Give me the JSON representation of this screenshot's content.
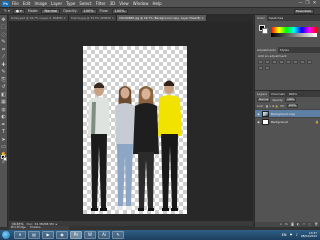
{
  "app": {
    "logo": "Ps"
  },
  "menubar": {
    "items": [
      "File",
      "Edit",
      "Image",
      "Layer",
      "Type",
      "Select",
      "Filter",
      "3D",
      "View",
      "Window",
      "Help"
    ],
    "window_controls": [
      "—",
      "❐",
      "✕"
    ]
  },
  "options_bar": {
    "mode_label": "Mode:",
    "mode_value": "Normal",
    "opacity_label": "Opacity:",
    "opacity_value": "100%",
    "flow_label": "Flow:",
    "flow_value": "100%",
    "workspace": "Essentials"
  },
  "document_tabs": [
    {
      "label": "family.psd @ 16.7% (Layer 0, RGB/8) ×",
      "active": false
    },
    {
      "label": "friends.jpg @ 33.3% (RGB/8) ×",
      "active": false
    },
    {
      "label": "DSC09868.jpg @ 16.7% (Background copy, Layer Mask/8) ×",
      "active": true
    }
  ],
  "status_bar": {
    "zoom": "16.67%",
    "doc_info": "Doc: 34.3M/68.5M",
    "arrow": "▸"
  },
  "tools": [
    "move-icon",
    "marquee-icon",
    "lasso-icon",
    "quick-select-icon",
    "crop-icon",
    "eyedropper-icon",
    "healing-icon",
    "brush-icon",
    "clone-icon",
    "history-brush-icon",
    "eraser-icon",
    "gradient-icon",
    "blur-icon",
    "dodge-icon",
    "pen-icon",
    "type-icon",
    "path-select-icon",
    "shape-icon",
    "hand-icon",
    "zoom-icon"
  ],
  "tool_glyphs": [
    "✥",
    "⬚",
    "◌",
    "✎",
    "⌗",
    "⁄",
    "✚",
    "✎",
    "⎘",
    "↺",
    "◧",
    "▦",
    "◍",
    "◐",
    "✒",
    "T",
    "➤",
    "▭",
    "✋",
    "⌕"
  ],
  "panels": {
    "color_tabs": [
      "Color",
      "Swatches"
    ],
    "adjustments_tabs": [
      "Adjustments",
      "Styles"
    ],
    "adjustments_title": "Add an adjustment",
    "layers_tabs": [
      "Layers",
      "Channels",
      "Paths"
    ],
    "blend_mode": "Normal",
    "opacity_label": "Opacity:",
    "opacity_value": "100%",
    "lock_label": "Lock:",
    "fill_label": "Fill:",
    "fill_value": "100%",
    "layers": [
      {
        "name": "Background copy",
        "visible": true,
        "selected": true,
        "thumb": "photo",
        "locked": false
      },
      {
        "name": "Background",
        "visible": true,
        "selected": false,
        "thumb": "white",
        "locked": true
      }
    ],
    "footer_icons": [
      "link-icon",
      "fx-icon",
      "mask-icon",
      "adjustment-icon",
      "folder-icon",
      "new-layer-icon",
      "trash-icon"
    ],
    "footer_glyphs": [
      "∞",
      "fx",
      "◙",
      "◐",
      "▭",
      "▢",
      "🗑"
    ]
  },
  "mini_bridge": {
    "tabs": [
      "Mini Bridge",
      "Timeline"
    ]
  },
  "taskbar": {
    "buttons": [
      {
        "name": "ie-icon",
        "glyph": "e",
        "active": false
      },
      {
        "name": "explorer-icon",
        "glyph": "▤",
        "active": false
      },
      {
        "name": "media-player-icon",
        "glyph": "▶",
        "active": false
      },
      {
        "name": "firefox-icon",
        "glyph": "◉",
        "active": false
      },
      {
        "name": "photoshop-icon",
        "glyph": "Ps",
        "active": true
      },
      {
        "name": "word-icon",
        "glyph": "W",
        "active": false
      },
      {
        "name": "illustrator-icon",
        "glyph": "Ai",
        "active": false
      },
      {
        "name": "paint-icon",
        "glyph": "✎",
        "active": false
      }
    ],
    "tray": {
      "lang": "EN",
      "time": "13:37",
      "date": "08/04/2015"
    }
  }
}
